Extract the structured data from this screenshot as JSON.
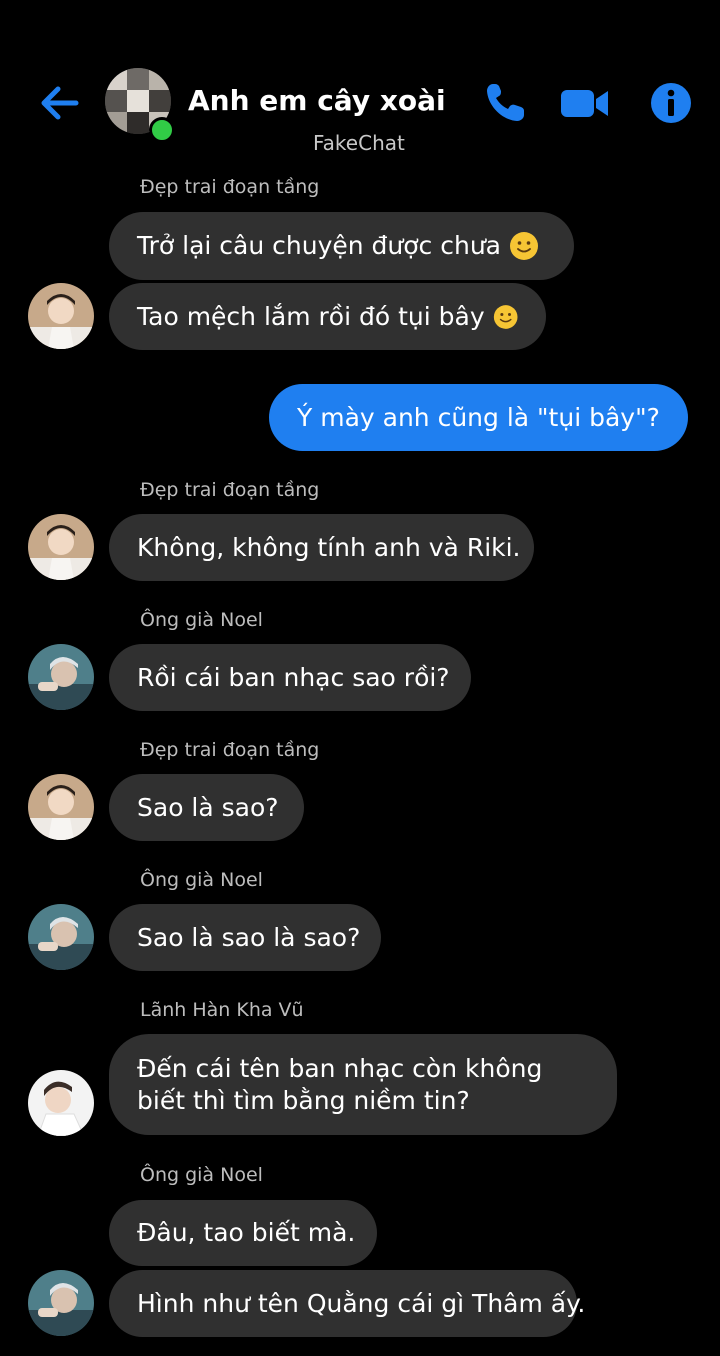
{
  "header": {
    "title": "Anh em cây xoài",
    "subtitle": "FakeChat",
    "accent_color": "#1f7ff0",
    "icons": [
      "back-arrow-icon",
      "phone-icon",
      "video-camera-icon",
      "info-icon"
    ]
  },
  "messages": [
    {
      "sender": "Đẹp trai đoạn tầng",
      "text": "Trở lại câu chuyện được chưa",
      "emoji": "slight-smile-emoji"
    },
    {
      "text": "Tao mệch lắm rồi đó tụi bây",
      "emoji": "slight-smile-emoji"
    },
    {
      "text": "Ý mày anh cũng là \"tụi bây\"?",
      "outgoing": true
    },
    {
      "sender": "Đẹp trai đoạn tầng",
      "text": "Không, không tính anh và Riki."
    },
    {
      "sender": "Ông già Noel",
      "text": "Rồi cái ban nhạc sao rồi?"
    },
    {
      "sender": "Đẹp trai đoạn tầng",
      "text": "Sao là sao?"
    },
    {
      "sender": "Ông già Noel",
      "text": "Sao là sao là sao?"
    },
    {
      "sender": "Lãnh Hàn Kha Vũ",
      "text": "Đến cái tên ban nhạc còn không biết thì tìm bằng niềm tin?"
    },
    {
      "sender": "Ông già Noel",
      "text": "Đâu, tao biết mà."
    },
    {
      "text": "Hình như tên Quằng cái gì Thâm ấy."
    }
  ]
}
